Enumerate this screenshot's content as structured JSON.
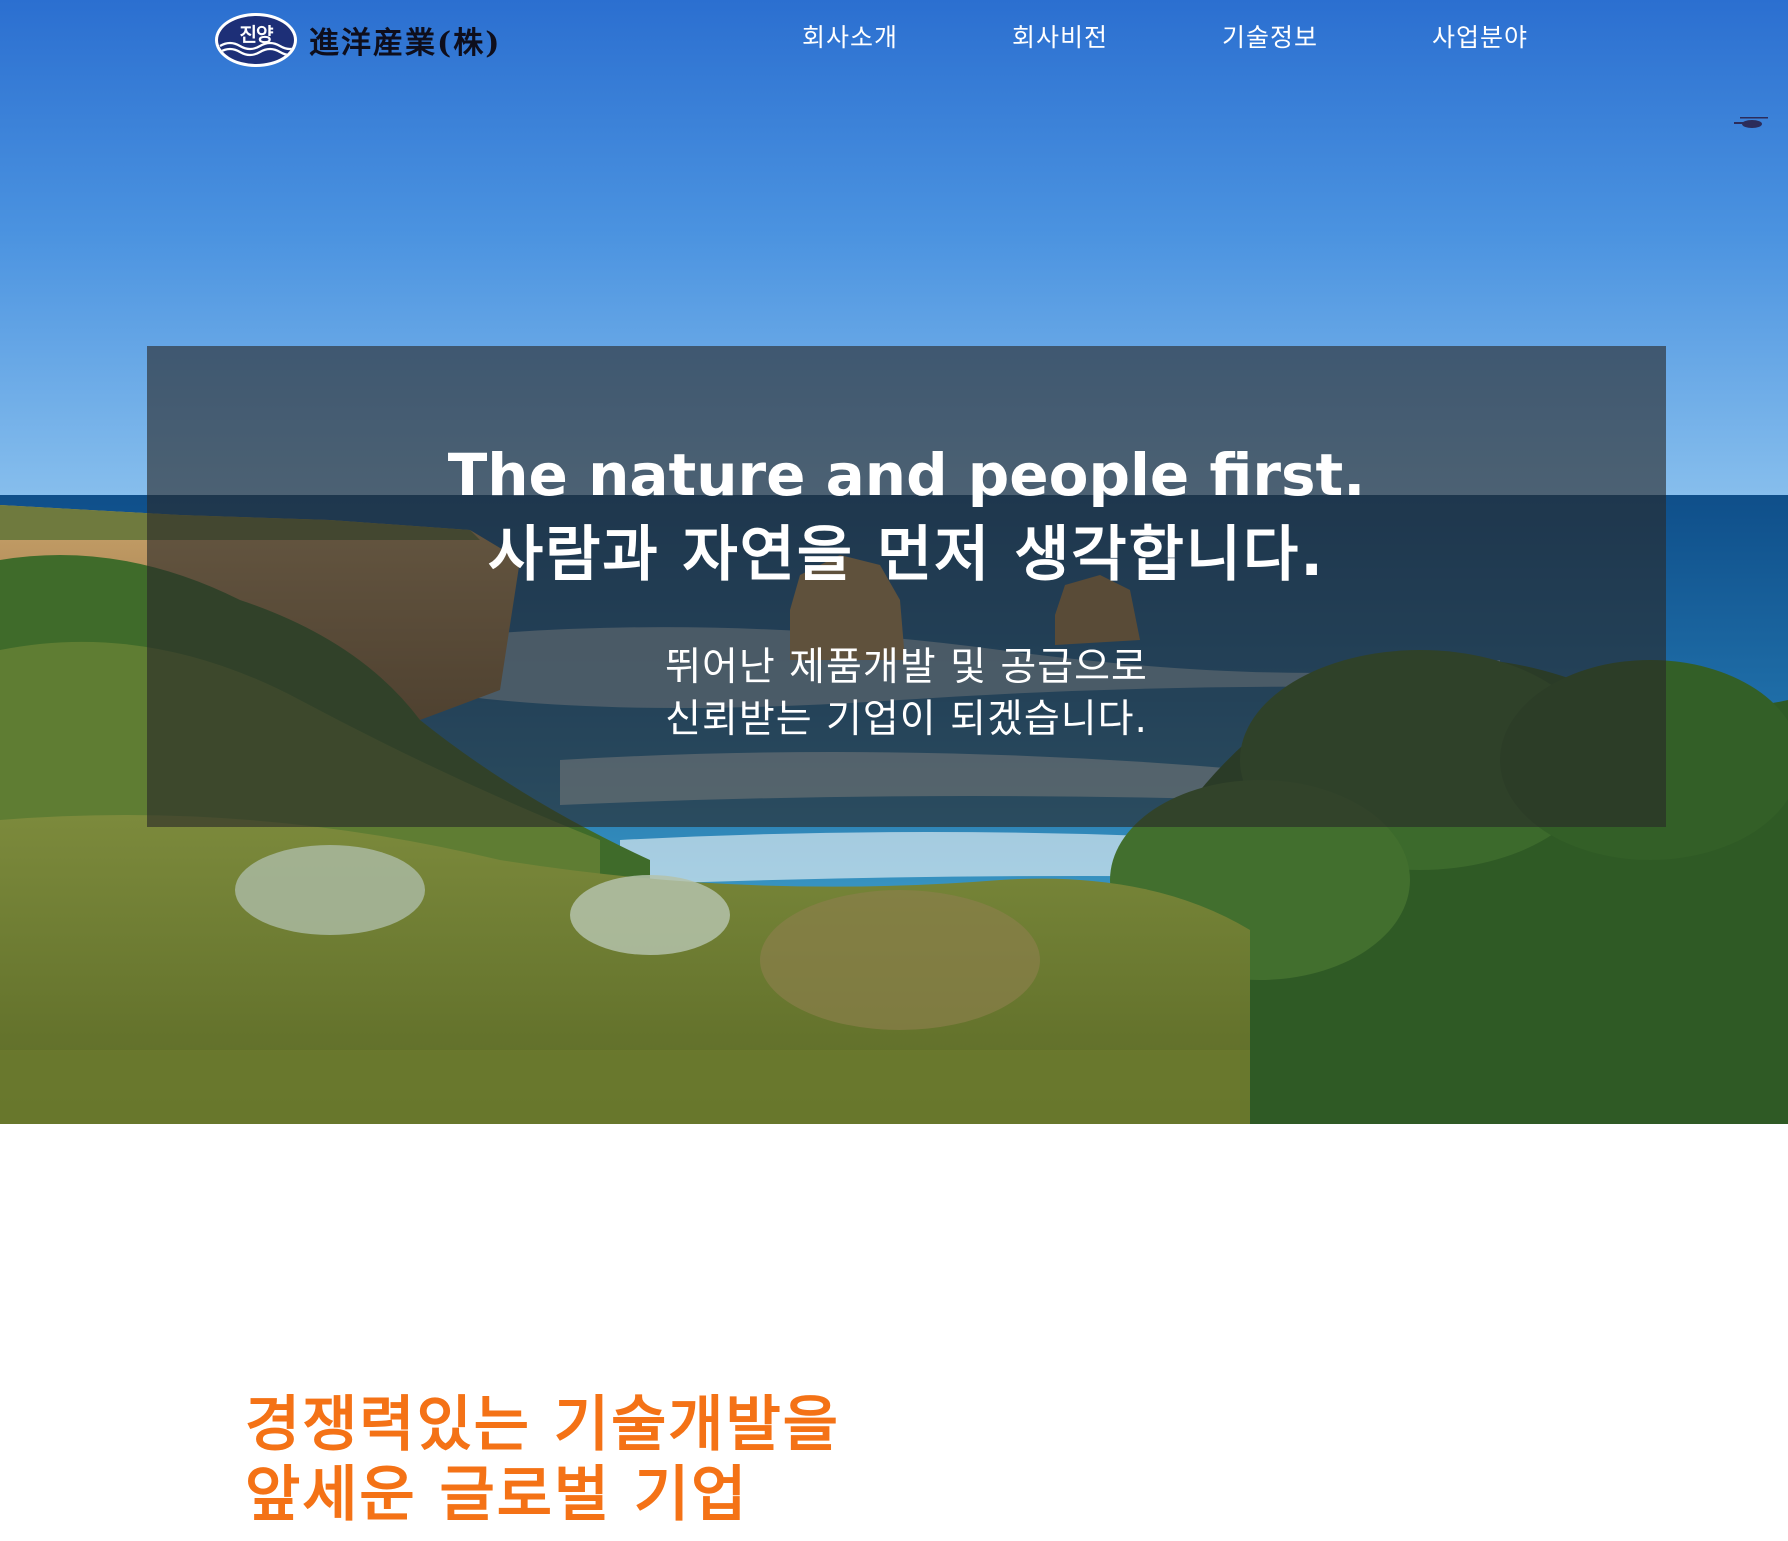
{
  "header": {
    "logo": {
      "emblem_text": "진양",
      "company_name": "進洋産業(株)"
    },
    "nav": [
      {
        "label": "회사소개"
      },
      {
        "label": "회사비전"
      },
      {
        "label": "기술정보"
      },
      {
        "label": "사업분야"
      }
    ]
  },
  "hero": {
    "headline_en": "The nature and people first.",
    "headline_ko": "사람과 자연을 먼저 생각합니다.",
    "subtext_line1": "뛰어난 제품개발 및 공급으로",
    "subtext_line2": "신뢰받는 기업이 되겠습니다."
  },
  "section": {
    "tagline_line1": "경쟁력있는 기술개발을",
    "tagline_line2": "앞세운 글로벌 기업"
  },
  "colors": {
    "accent_orange": "#f47216",
    "overlay": "#282828",
    "logo_blue": "#1d2f77"
  }
}
